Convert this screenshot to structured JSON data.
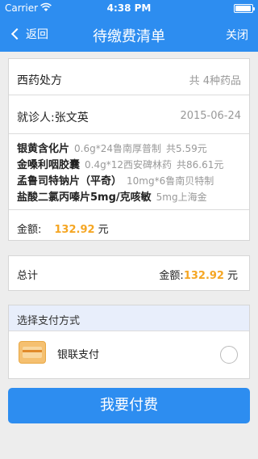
{
  "status_bar": {
    "carrier": "Carrier",
    "time": "4:38 PM"
  },
  "nav": {
    "back_label": "返回",
    "title": "待缴费清单",
    "close_label": "关闭"
  },
  "prescription": {
    "title": "西药处方",
    "count": "共 4种药品",
    "patient": "就诊人:张文英",
    "date": "2015-06-24",
    "drugs": [
      {
        "name": "银黄含化片",
        "spec": "0.6g*24鲁南厚普制",
        "total": "共5.59元"
      },
      {
        "name": "金嗓利咽胶囊",
        "spec": "0.4g*12西安碑林药",
        "total": "共86.61元"
      },
      {
        "name": "孟鲁司特钠片（平奇）",
        "spec": "10mg*6鲁南贝特制",
        "total": ""
      },
      {
        "name": "盐酸二氯丙嗪片5mg/克咳敏",
        "spec": "5mg上海金",
        "total": ""
      }
    ],
    "amount_label": "金额:",
    "amount_value": "132.92",
    "amount_unit": "元"
  },
  "total": {
    "label": "总计",
    "amount_prefix": "金额:",
    "amount_value": "132.92",
    "amount_unit": "元"
  },
  "payment": {
    "header": "选择支付方式",
    "method_label": "银联支付",
    "method_icon": "unionpay-card-icon"
  },
  "pay_button": {
    "label": "我要付费"
  },
  "colors": {
    "accent": "#2d8df0",
    "amount": "#f5a623"
  }
}
